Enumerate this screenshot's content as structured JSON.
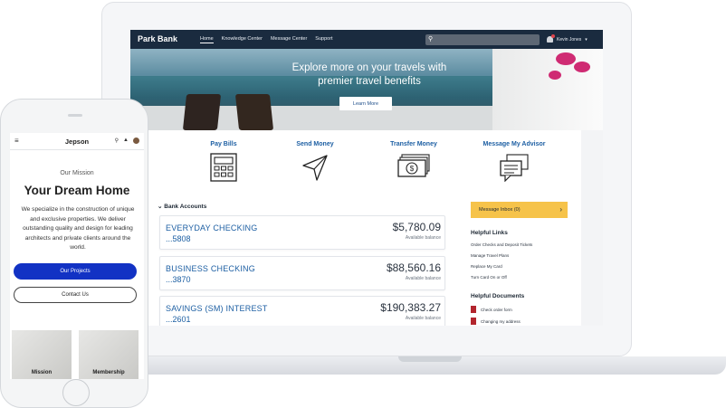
{
  "laptop": {
    "nav": {
      "brand": "Park Bank",
      "links": [
        "Home",
        "Knowledge Center",
        "Message Center",
        "Support"
      ],
      "user_name": "Kevin Jones",
      "user_chevron": "▾"
    },
    "hero": {
      "title_line1": "Explore more on your travels with",
      "title_line2": "premier travel benefits",
      "button_label": "Learn More"
    },
    "quick_actions": [
      {
        "label": "Pay Bills",
        "icon": "calculator-icon"
      },
      {
        "label": "Send Money",
        "icon": "paper-plane-icon"
      },
      {
        "label": "Transfer Money",
        "icon": "money-transfer-icon"
      },
      {
        "label": "Message My Advisor",
        "icon": "chat-bubbles-icon"
      }
    ],
    "accounts": {
      "heading": "Bank Accounts",
      "toggle": "⌄",
      "items": [
        {
          "name": "EVERYDAY CHECKING",
          "number": "...5808",
          "balance": "$5,780.09",
          "balance_label": "Available balance"
        },
        {
          "name": "BUSINESS CHECKING",
          "number": "...3870",
          "balance": "$88,560.16",
          "balance_label": "Available balance"
        },
        {
          "name": "SAVINGS (SM) INTEREST",
          "number": "...2601",
          "balance": "$190,383.27",
          "balance_label": "Available balance"
        }
      ]
    },
    "sidebar": {
      "inbox_label": "Message Inbox (0)",
      "inbox_chevron": "›",
      "helpful_links_heading": "Helpful Links",
      "helpful_links": [
        "Order Checks and Deposit Tickets",
        "Manage Travel Plans",
        "Replace My Card",
        "Turn Card On or Off"
      ],
      "helpful_docs_heading": "Helpful Documents",
      "helpful_docs": [
        "Check order form",
        "Changing my address"
      ]
    },
    "colors": {
      "nav_bg": "#1a2b3f",
      "link_blue": "#1d5fa3",
      "inbox_yellow": "#f6c34a"
    }
  },
  "phone": {
    "app_title": "Jepson",
    "menu_glyph": "≡",
    "search_glyph": "⚲",
    "bell_glyph": "🔔",
    "mission_label": "Our Mission",
    "headline": "Your Dream Home",
    "body": "We specialize in the construction of unique and exclusive properties.  We deliver outstanding quality and design for leading architects and private clients around the world.",
    "primary_button": "Our Projects",
    "secondary_button": "Contact Us",
    "cards": [
      "Mission",
      "Membership"
    ],
    "colors": {
      "primary": "#1232c4"
    }
  }
}
